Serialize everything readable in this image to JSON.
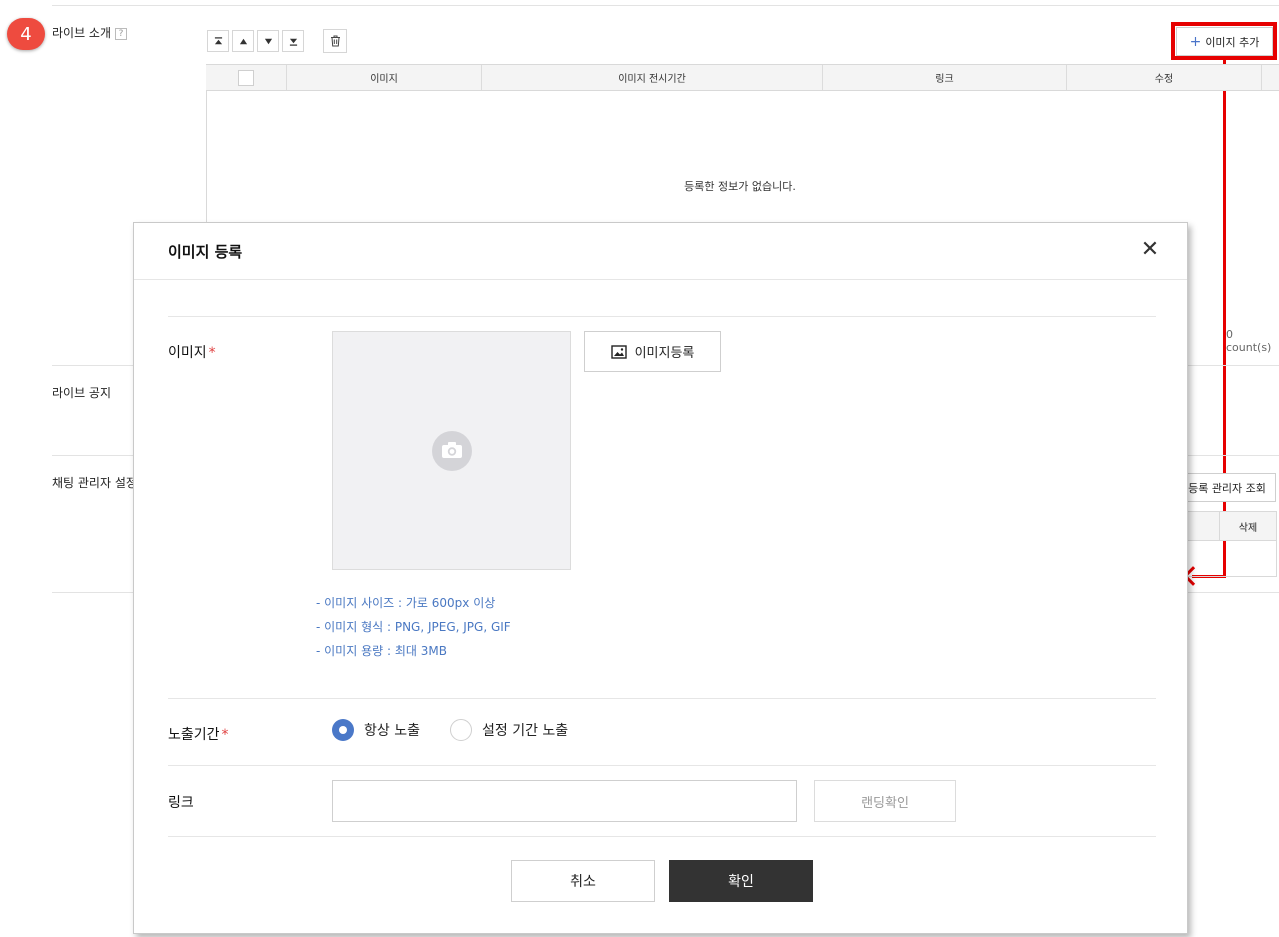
{
  "step_badge": "4",
  "sections": {
    "live_intro": "라이브 소개",
    "live_intro_help": "?",
    "live_notice": "라이브 공지",
    "chat_admin": "채팅 관리자 설정"
  },
  "toolbar": {
    "move_top": "▲̲",
    "move_up": "▲",
    "move_down": "▼",
    "move_bottom": "▼̲",
    "delete_icon": "🗑",
    "add_image": "이미지 추가",
    "add_icon": "+"
  },
  "intro_table": {
    "columns": [
      "이미지",
      "이미지 전시기간",
      "링크",
      "수정"
    ],
    "empty_message": "등록한 정보가 없습니다.",
    "count": "0 count(s)"
  },
  "admin": {
    "view_button": "등록 관리자 조회",
    "column": "삭제"
  },
  "modal": {
    "title": "이미지 등록",
    "close": "✕",
    "image_label": "이미지",
    "required_mark": "*",
    "register_button": "이미지등록",
    "notes": [
      "- 이미지 사이즈 : 가로 600px 이상",
      "- 이미지 형식 : PNG, JPEG, JPG, GIF",
      "- 이미지 용량 : 최대 3MB"
    ],
    "period_label": "노출기간",
    "period_options": [
      "항상 노출",
      "설정 기간 노출"
    ],
    "period_selected": "항상 노출",
    "link_label": "링크",
    "link_value": "",
    "landing_button": "랜딩확인",
    "cancel_button": "취소",
    "confirm_button": "확인"
  },
  "colors": {
    "highlight": "#e60000",
    "accent": "#4a78c8",
    "badge": "#ee4b3f",
    "confirm": "#333333"
  }
}
